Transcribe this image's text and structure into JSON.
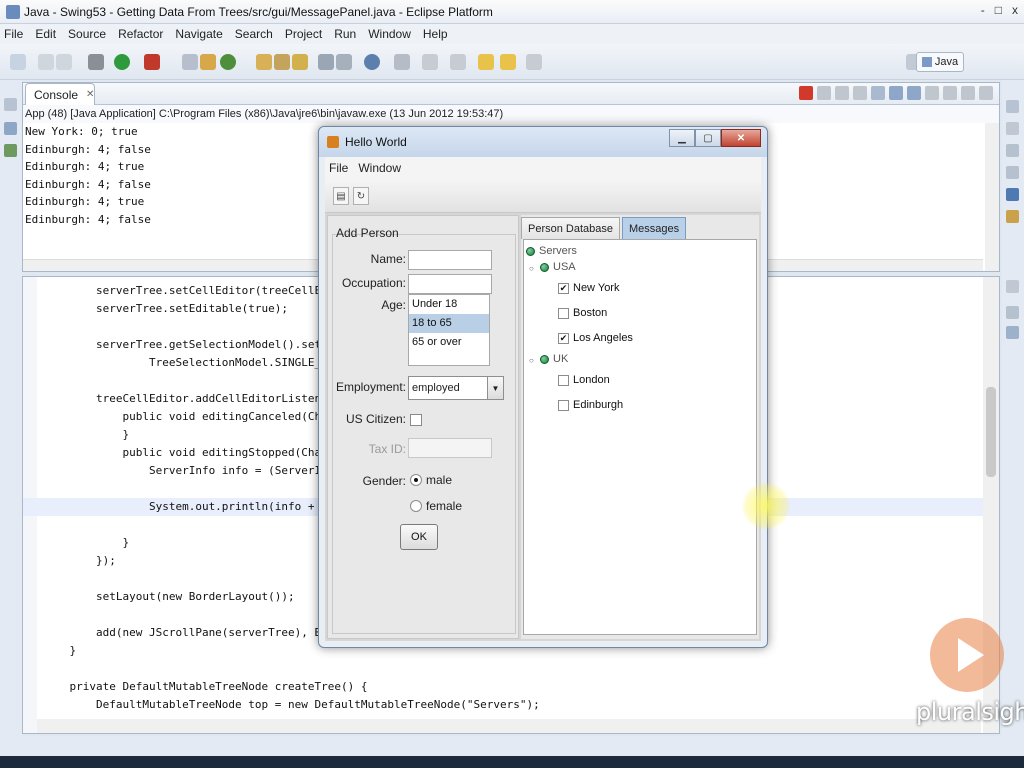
{
  "eclipse": {
    "title": "Java - Swing53 - Getting Data From Trees/src/gui/MessagePanel.java - Eclipse Platform",
    "window_controls": [
      "-",
      "□",
      "x"
    ],
    "menu": [
      "File",
      "Edit",
      "Source",
      "Refactor",
      "Navigate",
      "Search",
      "Project",
      "Run",
      "Window",
      "Help"
    ],
    "perspective": "Java"
  },
  "console": {
    "tab_label": "Console",
    "tab_close": "✕",
    "info": "App (48) [Java Application] C:\\Program Files (x86)\\Java\\jre6\\bin\\javaw.exe (13 Jun 2012 19:53:47)",
    "lines": [
      "New York: 0; true",
      "Edinburgh: 4; false",
      "Edinburgh: 4; true",
      "Edinburgh: 4; false",
      "Edinburgh: 4; true",
      "Edinburgh: 4; false"
    ]
  },
  "editor": {
    "lines": [
      {
        "indent": "        ",
        "text": "serverTree.setCellEditor(treeCellEdit"
      },
      {
        "indent": "        ",
        "text": "serverTree.setEditable(true);"
      },
      {
        "indent": "",
        "text": ""
      },
      {
        "indent": "        ",
        "text": "serverTree.getSelectionModel().setSel"
      },
      {
        "indent": "                ",
        "text": "TreeSelectionModel.SINGLE_TRE"
      },
      {
        "indent": "",
        "text": ""
      },
      {
        "indent": "        ",
        "text": "treeCellEditor.addCellEditorListener("
      },
      {
        "indent": "            ",
        "text": "public void editingCanceled(Change"
      },
      {
        "indent": "            ",
        "text": "}"
      },
      {
        "indent": "            ",
        "text": "public void editingStopped(Change"
      },
      {
        "indent": "                ",
        "text": "ServerInfo info = (ServerInfo"
      },
      {
        "indent": "",
        "text": ""
      },
      {
        "indent": "                ",
        "text": "System.out.println(info + \": "
      },
      {
        "indent": "",
        "text": ""
      },
      {
        "indent": "            ",
        "text": "}"
      },
      {
        "indent": "        ",
        "text": "});"
      },
      {
        "indent": "",
        "text": ""
      },
      {
        "indent": "        ",
        "text": "setLayout(new BorderLayout());"
      },
      {
        "indent": "",
        "text": ""
      },
      {
        "indent": "        ",
        "text": "add(new JScrollPane(serverTree), Bord"
      },
      {
        "indent": "    ",
        "text": "}"
      },
      {
        "indent": "",
        "text": ""
      },
      {
        "indent": "    ",
        "text": "private DefaultMutableTreeNode createTree() {"
      },
      {
        "indent": "        ",
        "text": "DefaultMutableTreeNode top = new DefaultMutableTreeNode(\"Servers\");"
      }
    ]
  },
  "hello_world": {
    "title": "Hello World",
    "menu": [
      "File",
      "Window"
    ],
    "form": {
      "group_title": "Add Person",
      "name_label": "Name:",
      "occupation_label": "Occupation:",
      "age_label": "Age:",
      "age_options": [
        "Under 18",
        "18 to 65",
        "65 or over"
      ],
      "age_selected_index": 1,
      "employment_label": "Employment:",
      "employment_value": "employed",
      "us_citizen_label": "US Citizen:",
      "tax_id_label": "Tax ID:",
      "gender_label": "Gender:",
      "gender_options": [
        "male",
        "female"
      ],
      "gender_selected": "male",
      "ok_label": "OK"
    },
    "tabs": [
      "Person Database",
      "Messages"
    ],
    "active_tab": "Messages",
    "tree": {
      "root": "Servers",
      "groups": [
        {
          "label": "USA",
          "children": [
            {
              "label": "New York",
              "checked": true
            },
            {
              "label": "Boston",
              "checked": false
            },
            {
              "label": "Los Angeles",
              "checked": true
            }
          ]
        },
        {
          "label": "UK",
          "children": [
            {
              "label": "London",
              "checked": false
            },
            {
              "label": "Edinburgh",
              "checked": false
            }
          ]
        }
      ],
      "check_glyph": "✔"
    }
  },
  "watermark": {
    "brand": "pluralsight"
  }
}
